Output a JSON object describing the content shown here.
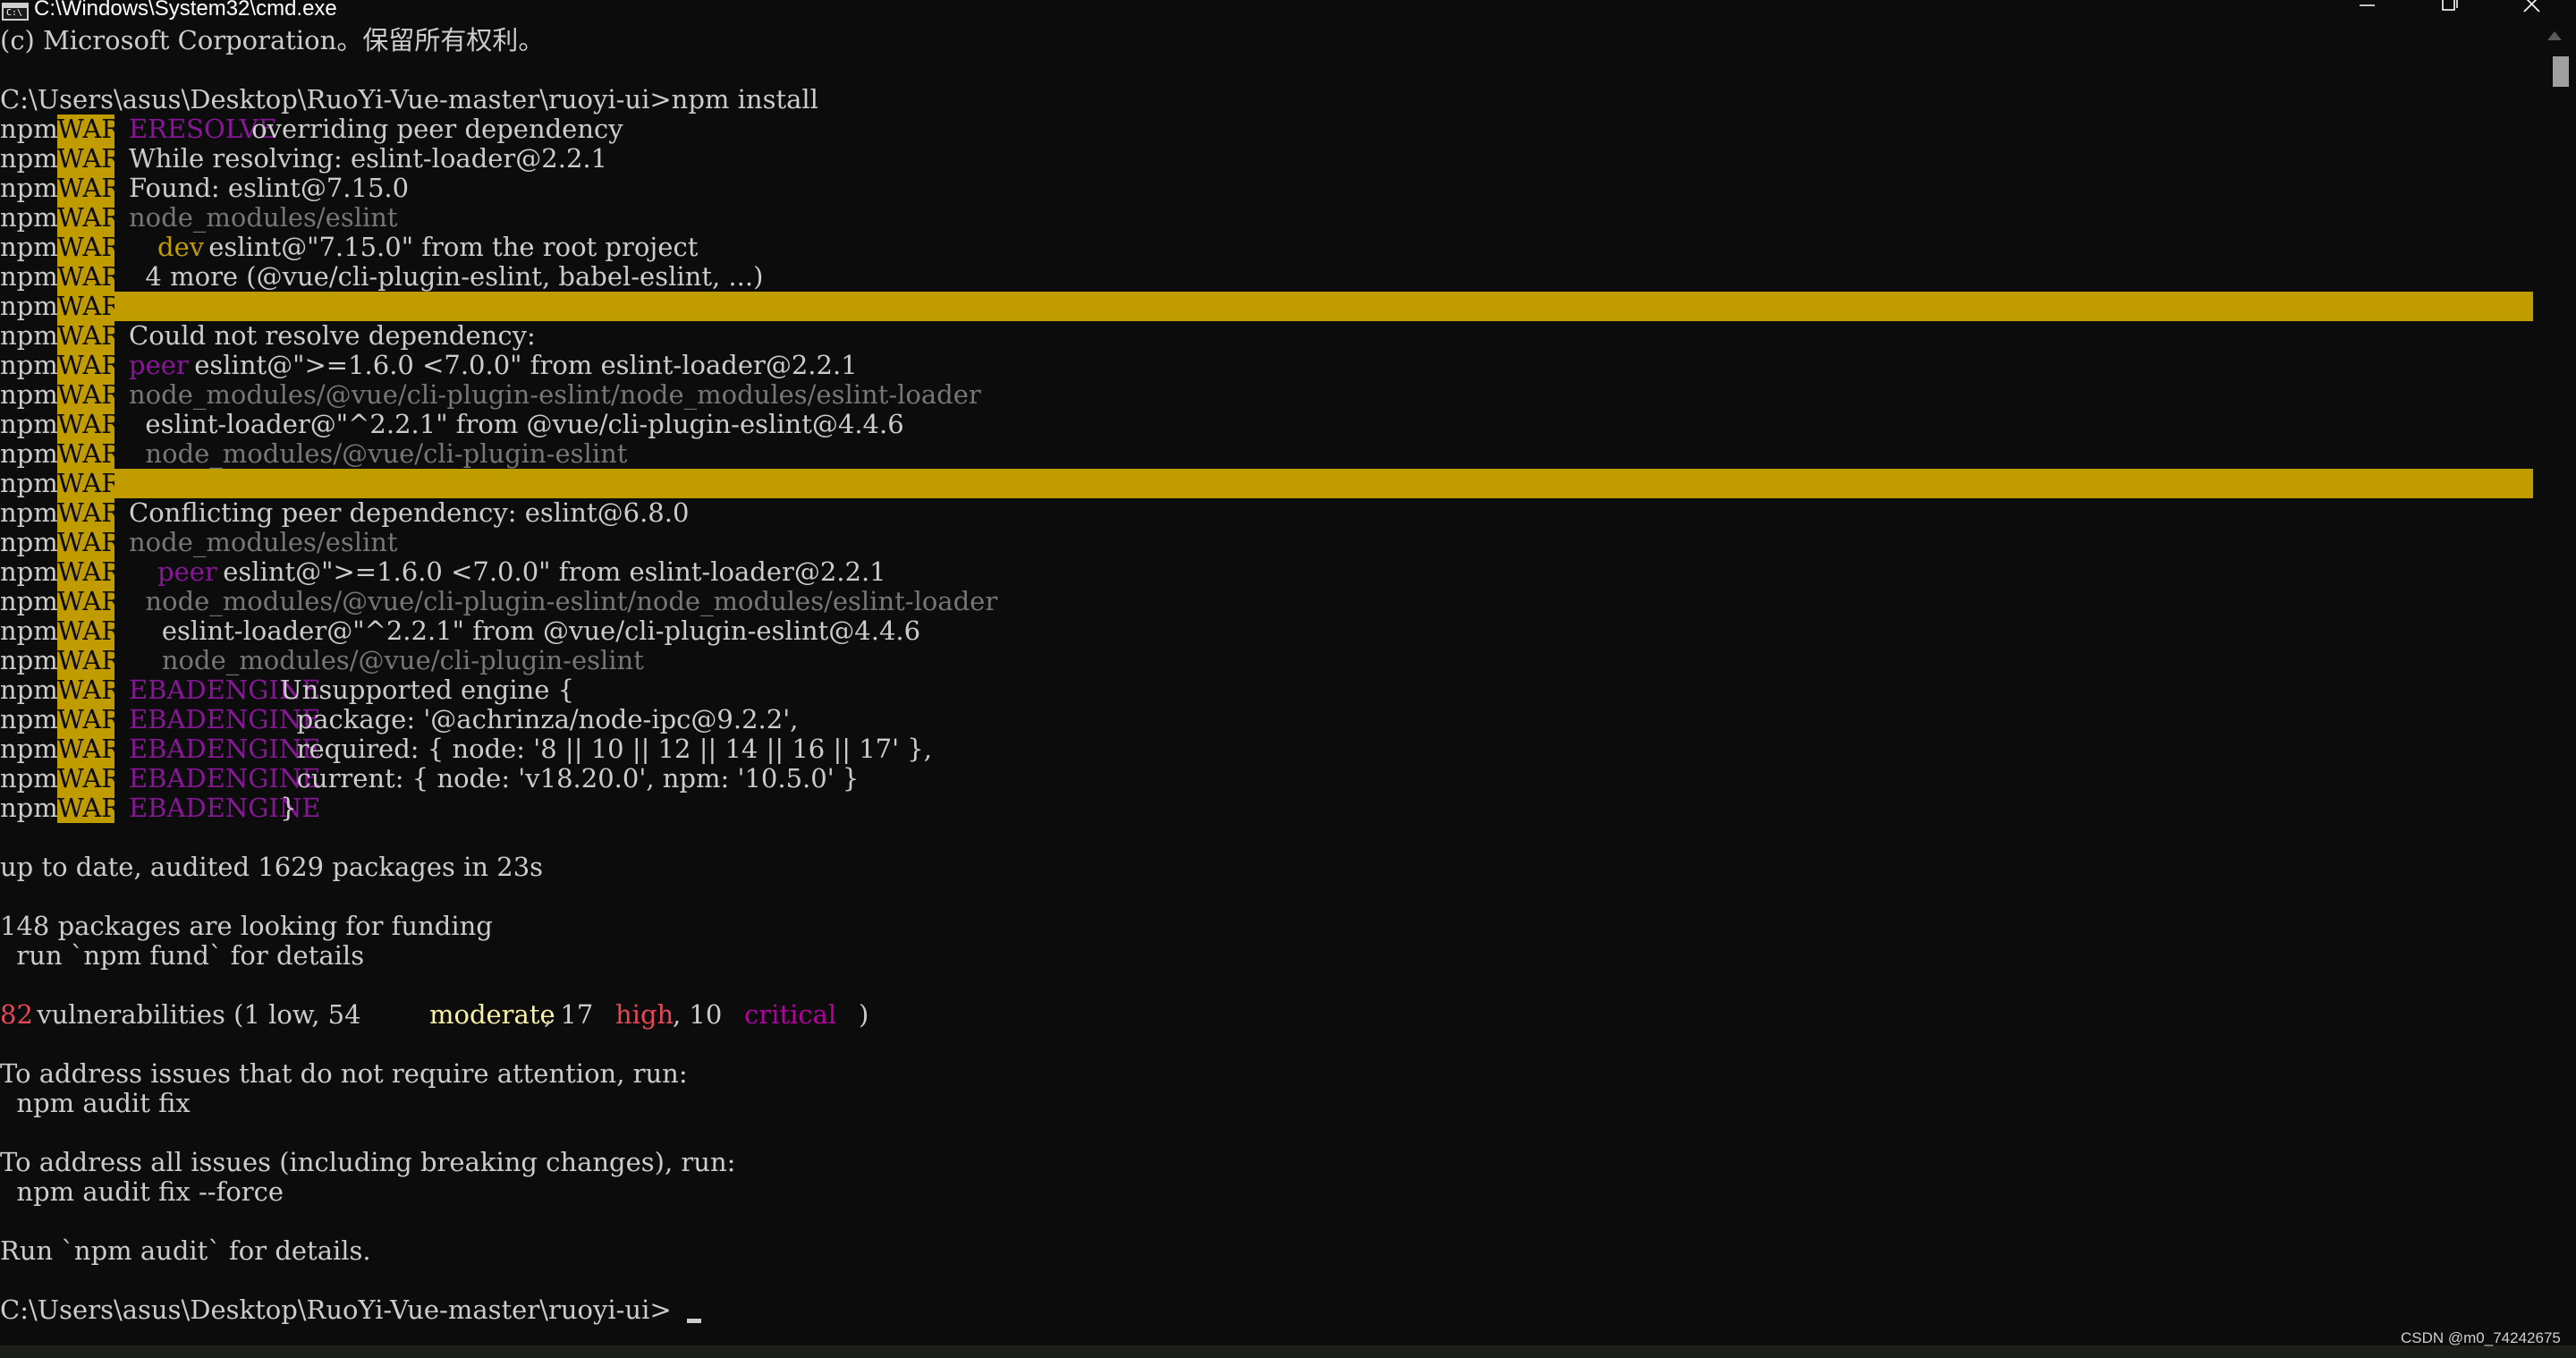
{
  "window": {
    "title": "C:\\Windows\\System32\\cmd.exe",
    "icon_label": "C:\\"
  },
  "controls": {
    "minimize_icon": "minimize-icon",
    "maximize_icon": "restore-icon",
    "close_icon": "close-icon"
  },
  "colors": {
    "background": "#0c0c0c",
    "foreground": "#cccccc",
    "warn_badge": "#c19c00",
    "magenta": "#881798",
    "gray": "#767676",
    "red": "#e74856",
    "light_yellow": "#f9f1a5",
    "light_magenta": "#b4009e"
  },
  "terminal": {
    "copyright": "(c) Microsoft Corporation。保留所有权利。",
    "command_line": "C:\\Users\\asus\\Desktop\\RuoYi-Vue-master\\ruoyi-ui>npm install",
    "npm_label": "npm",
    "warn_label": "WARN",
    "warnings": [
      [
        {
          "t": "ERESOLVE",
          "c": "c-magenta"
        },
        {
          "t": " overriding peer dependency",
          "c": "c-plain"
        }
      ],
      [
        {
          "t": "While resolving: eslint-loader@2.2.1",
          "c": "c-plain"
        }
      ],
      [
        {
          "t": "Found: eslint@7.15.0",
          "c": "c-plain"
        }
      ],
      [
        {
          "t": "node_modules/eslint",
          "c": "c-gray"
        }
      ],
      [
        {
          "t": "  ",
          "c": "c-plain"
        },
        {
          "t": "dev",
          "c": "c-yellow"
        },
        {
          "t": " eslint@\"7.15.0\" from the root project",
          "c": "c-plain"
        }
      ],
      [
        {
          "t": "  4 more (@vue/cli-plugin-eslint, babel-eslint, ...)",
          "c": "c-plain"
        }
      ],
      "banner",
      [
        {
          "t": "Could not resolve dependency:",
          "c": "c-plain"
        }
      ],
      [
        {
          "t": "peer",
          "c": "c-magenta"
        },
        {
          "t": " eslint@\">=1.6.0 <7.0.0\" from eslint-loader@2.2.1",
          "c": "c-plain"
        }
      ],
      [
        {
          "t": "node_modules/@vue/cli-plugin-eslint/node_modules/eslint-loader",
          "c": "c-gray"
        }
      ],
      [
        {
          "t": "  eslint-loader@\"^2.2.1\" from @vue/cli-plugin-eslint@4.4.6",
          "c": "c-plain"
        }
      ],
      [
        {
          "t": "  node_modules/@vue/cli-plugin-eslint",
          "c": "c-gray"
        }
      ],
      "banner",
      [
        {
          "t": "Conflicting peer dependency: eslint@6.8.0",
          "c": "c-plain"
        }
      ],
      [
        {
          "t": "node_modules/eslint",
          "c": "c-gray"
        }
      ],
      [
        {
          "t": "  ",
          "c": "c-plain"
        },
        {
          "t": "peer",
          "c": "c-magenta"
        },
        {
          "t": " eslint@\">=1.6.0 <7.0.0\" from eslint-loader@2.2.1",
          "c": "c-plain"
        }
      ],
      [
        {
          "t": "  node_modules/@vue/cli-plugin-eslint/node_modules/eslint-loader",
          "c": "c-gray"
        }
      ],
      [
        {
          "t": "    eslint-loader@\"^2.2.1\" from @vue/cli-plugin-eslint@4.4.6",
          "c": "c-plain"
        }
      ],
      [
        {
          "t": "    node_modules/@vue/cli-plugin-eslint",
          "c": "c-gray"
        }
      ],
      [
        {
          "t": "EBADENGINE",
          "c": "c-magenta"
        },
        {
          "t": " Unsupported engine {",
          "c": "c-plain"
        }
      ],
      [
        {
          "t": "EBADENGINE",
          "c": "c-magenta"
        },
        {
          "t": "   package: '@achrinza/node-ipc@9.2.2',",
          "c": "c-plain"
        }
      ],
      [
        {
          "t": "EBADENGINE",
          "c": "c-magenta"
        },
        {
          "t": "   required: { node: '8 || 10 || 12 || 14 || 16 || 17' },",
          "c": "c-plain"
        }
      ],
      [
        {
          "t": "EBADENGINE",
          "c": "c-magenta"
        },
        {
          "t": "   current: { node: 'v18.20.0', npm: '10.5.0' }",
          "c": "c-plain"
        }
      ],
      [
        {
          "t": "EBADENGINE",
          "c": "c-magenta"
        },
        {
          "t": " }",
          "c": "c-plain"
        }
      ]
    ],
    "audit_summary": "up to date, audited 1629 packages in 23s",
    "funding_line": "148 packages are looking for funding",
    "funding_hint": "  run `npm fund` for details",
    "vulnerabilities": [
      {
        "t": "82",
        "c": "c-red"
      },
      {
        "t": " vulnerabilities (1 low, 54 ",
        "c": "c-plain"
      },
      {
        "t": "moderate",
        "c": "c-lyellow"
      },
      {
        "t": ", 17 ",
        "c": "c-plain"
      },
      {
        "t": "high",
        "c": "c-red"
      },
      {
        "t": ", 10 ",
        "c": "c-plain"
      },
      {
        "t": "critical",
        "c": "c-lmagenta"
      },
      {
        "t": ")",
        "c": "c-plain"
      }
    ],
    "fix_line": "To address issues that do not require attention, run:",
    "fix_cmd": "  npm audit fix",
    "force_line": "To address all issues (including breaking changes), run:",
    "force_cmd": "  npm audit fix --force",
    "details_line": "Run `npm audit` for details.",
    "prompt": "C:\\Users\\asus\\Desktop\\RuoYi-Vue-master\\ruoyi-ui>"
  },
  "watermark": "CSDN @m0_74242675"
}
